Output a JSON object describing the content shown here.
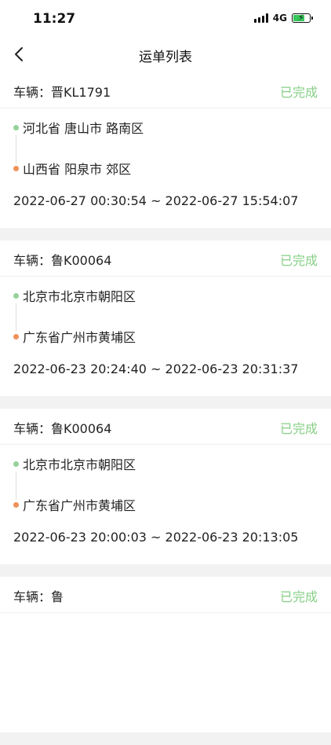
{
  "status_bar": {
    "time": "11:27",
    "network": "4G",
    "battery_icon": "battery-charging-icon"
  },
  "nav": {
    "title": "运单列表",
    "back_icon": "chevron-left-icon"
  },
  "colors": {
    "completed": "#86cf86",
    "origin_dot": "#94d39a",
    "destination_dot": "#f0915a"
  },
  "orders": [
    {
      "vehicle": "车辆：晋KL1791",
      "status": "已完成",
      "from": "河北省 唐山市 路南区",
      "to": "山西省 阳泉市 郊区",
      "time_range": "2022-06-27 00:30:54 ~ 2022-06-27 15:54:07"
    },
    {
      "vehicle": "车辆：鲁K00064",
      "status": "已完成",
      "from": "北京市北京市朝阳区",
      "to": "广东省广州市黄埔区",
      "time_range": "2022-06-23 20:24:40 ~ 2022-06-23 20:31:37"
    },
    {
      "vehicle": "车辆：鲁K00064",
      "status": "已完成",
      "from": "北京市北京市朝阳区",
      "to": "广东省广州市黄埔区",
      "time_range": "2022-06-23 20:00:03 ~ 2022-06-23 20:13:05"
    },
    {
      "vehicle": "车辆：鲁",
      "status": "已完成",
      "from": "",
      "to": "",
      "time_range": ""
    }
  ]
}
